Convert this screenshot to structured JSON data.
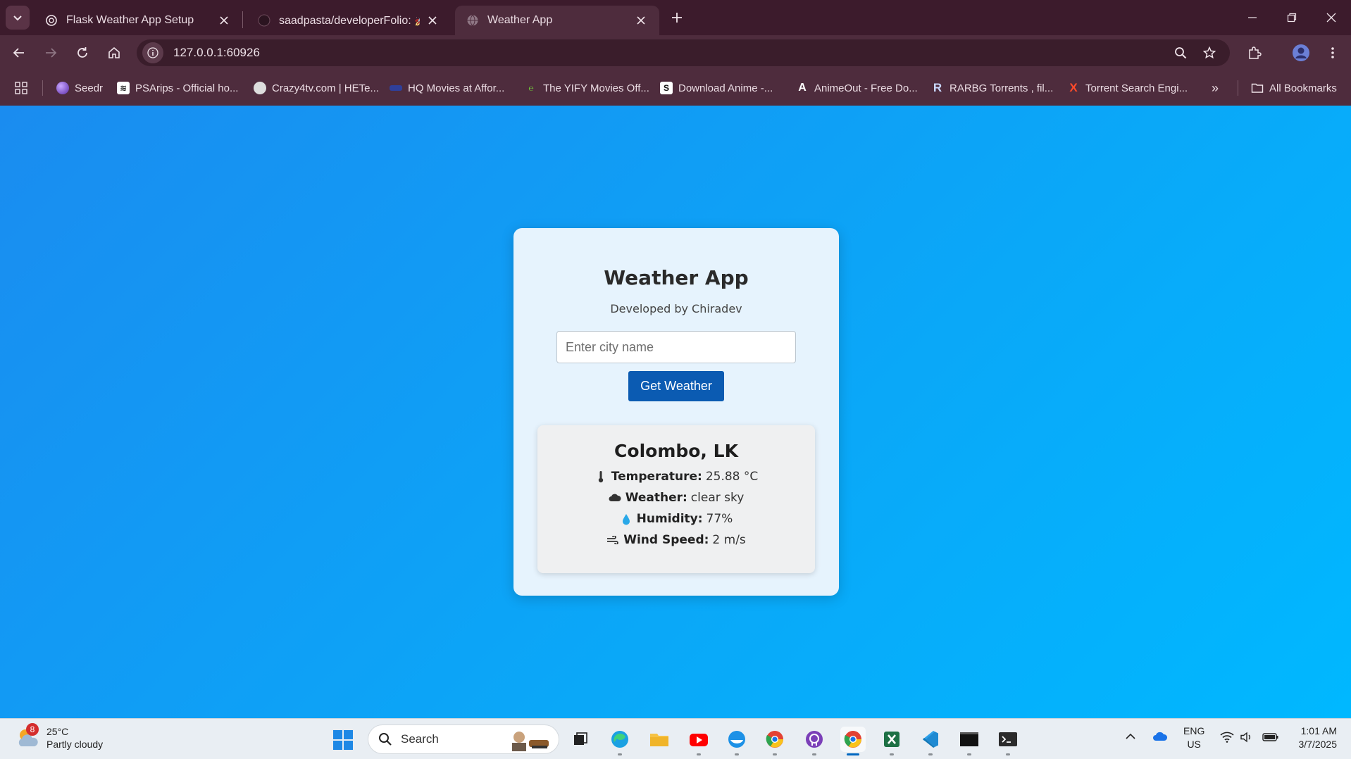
{
  "browser": {
    "tabs": [
      {
        "title": "Flask Weather App Setup",
        "favicon": "openai-icon",
        "active": false
      },
      {
        "title": "saadpasta/developerFolio: 🚀 S",
        "favicon": "github-icon",
        "active": false
      },
      {
        "title": "Weather App",
        "favicon": "globe-icon",
        "active": true
      }
    ],
    "url": "127.0.0.1:60926",
    "bookmarks": [
      {
        "label": "Seedr",
        "icon": "seedr-icon"
      },
      {
        "label": "PSArips - Official ho...",
        "icon": "psa-icon"
      },
      {
        "label": "Crazy4tv.com | HETe...",
        "icon": "crazy4tv-icon"
      },
      {
        "label": "HQ Movies at Affor...",
        "icon": "hqmovies-icon"
      },
      {
        "label": "The YIFY Movies Off...",
        "icon": "yify-icon"
      },
      {
        "label": "Download Anime -...",
        "icon": "anime-s-icon"
      },
      {
        "label": "AnimeOut - Free Do...",
        "icon": "animeout-icon"
      },
      {
        "label": "RARBG Torrents , fil...",
        "icon": "rarbg-icon"
      },
      {
        "label": "Torrent Search Engi...",
        "icon": "torrent-x-icon"
      }
    ],
    "all_bookmarks_label": "All Bookmarks"
  },
  "app": {
    "title": "Weather App",
    "subtitle": "Developed by Chiradev",
    "city_placeholder": "Enter city name",
    "button_label": "Get Weather",
    "result": {
      "location": "Colombo, LK",
      "temperature_label": "Temperature:",
      "temperature_value": "25.88 °C",
      "weather_label": "Weather:",
      "weather_value": "clear sky",
      "humidity_label": "Humidity:",
      "humidity_value": "77%",
      "wind_label": "Wind Speed:",
      "wind_value": "2 m/s"
    }
  },
  "taskbar": {
    "weather_temp": "25°C",
    "weather_desc": "Partly cloudy",
    "weather_badge": "8",
    "search_label": "Search",
    "lang_top": "ENG",
    "lang_bottom": "US",
    "time": "1:01 AM",
    "date": "3/7/2025"
  },
  "colors": {
    "page_gradient_start": "#1a8cf0",
    "page_gradient_end": "#00b8ff",
    "button": "#0b5bb2",
    "browser_frame": "#4e2c3d"
  }
}
